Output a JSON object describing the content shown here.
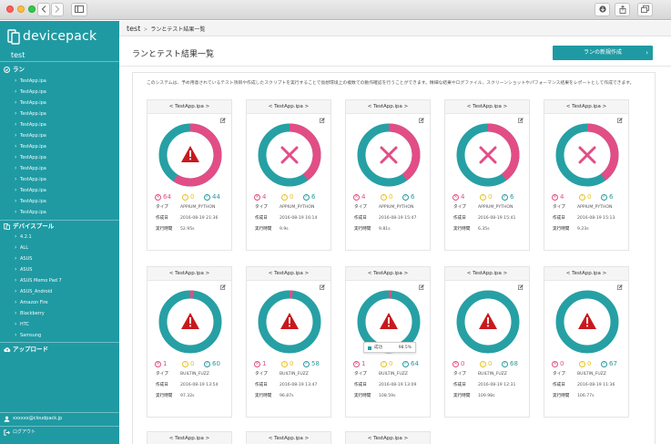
{
  "sidebar": {
    "logo_text": "devicepack",
    "project": "test",
    "run_section": "ラン",
    "runs": [
      "TestApp.ipa",
      "TestApp.ipa",
      "TestApp.ipa",
      "TestApp.ipa",
      "TestApp.ipa",
      "TestApp.ipa",
      "TestApp.ipa",
      "TestApp.ipa",
      "TestApp.ipa",
      "TestApp.ipa",
      "TestApp.ipa",
      "TestApp.ipa",
      "TestApp.ipa"
    ],
    "pool_section": "デバイスプール",
    "pools": [
      "4.2.1",
      "ALL",
      "ASUS",
      "ASUS",
      "ASUS Memo Pad 7",
      "ASUS_Android",
      "Amazon Fire",
      "Blackberry",
      "HTC",
      "Samsung"
    ],
    "upload_label": "アップロード",
    "user_email": "xxxxxx@cloudpack.jp",
    "logout_label": "ログアウト"
  },
  "breadcrumb": {
    "project": "test",
    "current": "ランとテスト結果一覧"
  },
  "page": {
    "title": "ランとテスト結果一覧",
    "new_run_button": "ランの新規作成",
    "description": "このシステムは、予め用意されているテスト項目や作成したスクリプトを実行することで仮想環境上の複数での動作確認を行うことができます。精細な結果やログファイル、スクリーンショットやパフォーマンス結果をレポートとして作成できます。"
  },
  "labels": {
    "type": "タイプ",
    "created": "作成日",
    "duration": "実行時間"
  },
  "colors": {
    "teal": "#1f9aa3",
    "ring_teal": "#26a0a4",
    "pink": "#e24d86",
    "warn_red": "#c8191d",
    "error_pink": "#e24d86",
    "warn_yellow": "#e6c321",
    "ok_teal": "#2a9aa0"
  },
  "cards_row1": [
    {
      "title": "< TestApp.ipa >",
      "status_icon": "warning-icon",
      "fail_fraction": 0.59,
      "errors": "64",
      "warnings": "0",
      "passed": "44",
      "type": "APPIUM_PYTHON",
      "created": "2016-08-19 21:36",
      "duration": "52.95s"
    },
    {
      "title": "< TestApp.ipa >",
      "status_icon": "cross-icon",
      "fail_fraction": 0.4,
      "errors": "4",
      "warnings": "0",
      "passed": "6",
      "type": "APPIUM_PYTHON",
      "created": "2016-08-19 16:14",
      "duration": "9.9s"
    },
    {
      "title": "< TestApp.ipa >",
      "status_icon": "cross-icon",
      "fail_fraction": 0.4,
      "errors": "4",
      "warnings": "0",
      "passed": "6",
      "type": "APPIUM_PYTHON",
      "created": "2016-08-19 15:47",
      "duration": "9.81s"
    },
    {
      "title": "< TestApp.ipa >",
      "status_icon": "cross-icon",
      "fail_fraction": 0.4,
      "errors": "4",
      "warnings": "0",
      "passed": "6",
      "type": "APPIUM_PYTHON",
      "created": "2016-08-19 15:41",
      "duration": "6.35s"
    },
    {
      "title": "< TestApp.ipa >",
      "status_icon": "cross-icon",
      "fail_fraction": 0.4,
      "errors": "4",
      "warnings": "0",
      "passed": "6",
      "type": "APPIUM_PYTHON",
      "created": "2016-08-19 15:13",
      "duration": "9.23s"
    }
  ],
  "cards_row2": [
    {
      "title": "< TestApp.ipa >",
      "status_icon": "warning-icon",
      "fail_fraction": 0.016,
      "errors": "1",
      "warnings": "0",
      "passed": "60",
      "type": "BUILTIN_FUZZ",
      "created": "2016-08-19 13:54",
      "duration": "97.32s"
    },
    {
      "title": "< TestApp.ipa >",
      "status_icon": "warning-icon",
      "fail_fraction": 0.017,
      "errors": "1",
      "warnings": "0",
      "passed": "58",
      "type": "BUILTIN_FUZZ",
      "created": "2016-08-19 13:47",
      "duration": "96.87s"
    },
    {
      "title": "< TestApp.ipa >",
      "status_icon": "warning-icon",
      "fail_fraction": 0.015,
      "errors": "1",
      "warnings": "0",
      "passed": "64",
      "type": "BUILTIN_FUZZ",
      "created": "2016-08-19 13:09",
      "duration": "108.59s",
      "tooltip": {
        "label": "成功",
        "value": "98.5%"
      }
    },
    {
      "title": "< TestApp.ipa >",
      "status_icon": "warning-icon",
      "fail_fraction": 0,
      "errors": "0",
      "warnings": "0",
      "passed": "68",
      "type": "BUILTIN_FUZZ",
      "created": "2016-08-19 12:31",
      "duration": "109.98s"
    },
    {
      "title": "< TestApp.ipa >",
      "status_icon": "warning-icon",
      "fail_fraction": 0,
      "errors": "0",
      "warnings": "0",
      "passed": "67",
      "type": "BUILTIN_FUZZ",
      "created": "2016-08-19 11:36",
      "duration": "106.77s"
    }
  ],
  "cards_row3": [
    "< TestApp.ipa >",
    "< TestApp.ipa >",
    "< TestApp.ipa >"
  ]
}
